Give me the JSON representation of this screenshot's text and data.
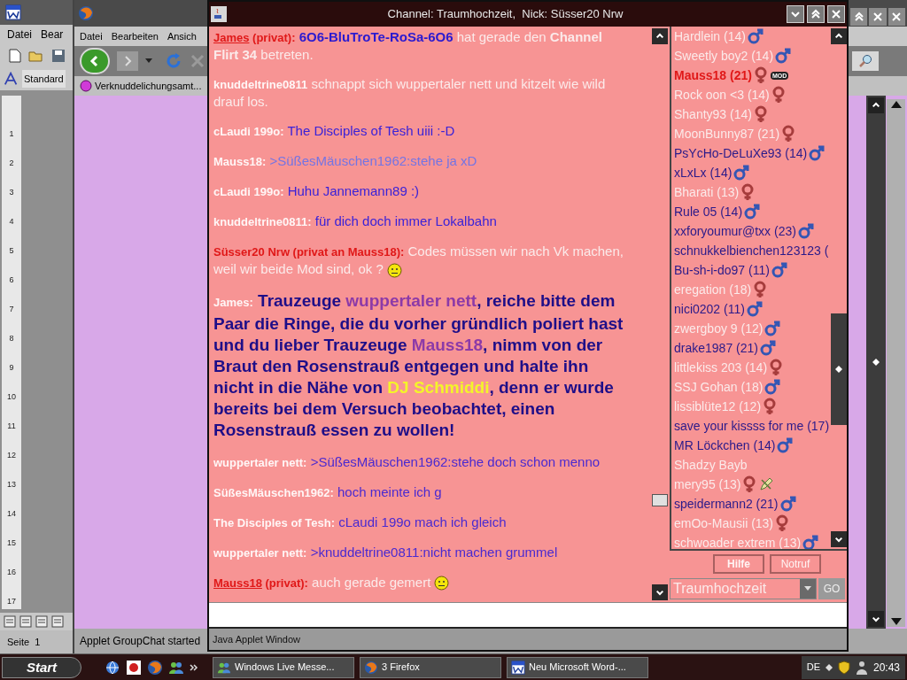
{
  "word": {
    "menu": [
      "Datei",
      "Bear"
    ],
    "style_box": "Standard",
    "ruler_labels": [
      "1",
      "2",
      "3",
      "4",
      "5",
      "6",
      "7",
      "8",
      "9",
      "10",
      "11",
      "12",
      "13",
      "14",
      "15",
      "16",
      "17"
    ],
    "status": "Seite  1"
  },
  "firefox": {
    "menu": [
      "Datei",
      "Bearbeiten",
      "Ansich"
    ],
    "bookmark": "Verknuddelichungsamt...",
    "status": "Applet GroupChat started"
  },
  "chat": {
    "title": "Channel: Traumhochzeit,  Nick: Süsser20 Nrw",
    "messages": [
      {
        "sender": "James",
        "kind": "private",
        "underline": true,
        "tag": "(privat):",
        "parts": [
          {
            "kind": "text",
            "text": "**6O6-BluTroTe-RoSa-6O6**",
            "color": "#2a1ad0"
          },
          {
            "kind": "text",
            "text": " hat gerade den **Channel Flirt 34** betreten.",
            "color": "#fbeaea"
          }
        ]
      },
      {
        "sender": "knuddeltrine0811",
        "kind": "public",
        "underline": false,
        "parts": [
          {
            "kind": "text",
            "text": " schnappt sich wuppertaler nett und kitzelt wie wild drauf los.",
            "color": "#fbeaea"
          }
        ]
      },
      {
        "sender": "cLaudi 199o:",
        "kind": "public",
        "underline": false,
        "parts": [
          {
            "kind": "text",
            "text": "The Disciples of Tesh uiii :-D",
            "color": "#3a22d8"
          }
        ]
      },
      {
        "sender": "Mauss18:",
        "kind": "public",
        "underline": false,
        "parts": [
          {
            "kind": "text",
            "text": ">SüßesMäuschen1962:stehe ja xD",
            "color": "#7474e4"
          }
        ]
      },
      {
        "sender": "cLaudi 199o:",
        "kind": "public",
        "underline": false,
        "parts": [
          {
            "kind": "text",
            "text": "Huhu Jannemann89 :)",
            "color": "#3a22d8"
          }
        ]
      },
      {
        "sender": "knuddeltrine0811:",
        "kind": "public",
        "underline": false,
        "parts": [
          {
            "kind": "text",
            "text": "für dich doch immer Lokalbahn",
            "color": "#3a22d8"
          }
        ]
      },
      {
        "sender": "Süsser20 Nrw (privat an Mauss18):",
        "kind": "private",
        "underline": false,
        "parts": [
          {
            "kind": "text",
            "text": "Codes müssen wir nach Vk machen, weil wir beide Mod sind, ok ?",
            "color": "#fbeaea"
          },
          {
            "kind": "smiley"
          }
        ]
      },
      {
        "sender": "James:",
        "kind": "announcement",
        "underline": false,
        "parts": [
          {
            "kind": "text",
            "text": "Trauzeuge ",
            "color": "#1e0e88"
          },
          {
            "kind": "text",
            "text": "wuppertaler nett",
            "color": "#8c3aa8"
          },
          {
            "kind": "text",
            "text": ", reiche bitte dem Paar die Ringe, die du vorher gründlich poliert hast und du lieber Trauzeuge ",
            "color": "#1e0e88"
          },
          {
            "kind": "text",
            "text": "Mauss18",
            "color": "#8c3aa8"
          },
          {
            "kind": "text",
            "text": ", nimm von der Braut den Rosenstrauß entgegen und halte ihn nicht in die Nähe von ",
            "color": "#1e0e88"
          },
          {
            "kind": "text",
            "text": "DJ Schmiddi",
            "color": "#f4f42a"
          },
          {
            "kind": "text",
            "text": ", denn er wurde bereits bei dem Versuch beobachtet, einen Rosenstrauß essen zu wollen!",
            "color": "#1e0e88"
          }
        ]
      },
      {
        "sender": "wuppertaler nett:",
        "kind": "public",
        "underline": false,
        "parts": [
          {
            "kind": "text",
            "text": ">SüßesMäuschen1962:stehe doch schon menno",
            "color": "#4a2ad0"
          }
        ]
      },
      {
        "sender": "SüßesMäuschen1962:",
        "kind": "public",
        "underline": false,
        "parts": [
          {
            "kind": "text",
            "text": "hoch meinte ich g",
            "color": "#4a2ad0"
          }
        ]
      },
      {
        "sender": "The Disciples of Tesh:",
        "kind": "public",
        "underline": false,
        "parts": [
          {
            "kind": "text",
            "text": "cLaudi  199o  mach ich gleich",
            "color": "#4a2ad0"
          }
        ]
      },
      {
        "sender": "wuppertaler nett:",
        "kind": "public",
        "underline": false,
        "parts": [
          {
            "kind": "text",
            "text": ">knuddeltrine0811:nicht machen grummel",
            "color": "#4a2ad0"
          }
        ]
      },
      {
        "sender": "Mauss18",
        "kind": "private",
        "underline": true,
        "tag": "(privat):",
        "parts": [
          {
            "kind": "text",
            "text": "auch gerade gemert",
            "color": "#fbeaea"
          },
          {
            "kind": "smiley"
          }
        ]
      }
    ],
    "users": [
      {
        "name": "Hardlein (14)",
        "color": "#fbeaea",
        "bold": false,
        "kind": "male",
        "pencil": false
      },
      {
        "name": "Sweetly boy2 (14)",
        "color": "#fbeaea",
        "bold": false,
        "kind": "male",
        "pencil": false
      },
      {
        "name": "Mauss18 (21)",
        "color": "#e01818",
        "bold": true,
        "kind": "female",
        "badge": "MOD",
        "pencil": false
      },
      {
        "name": "Rock oon <3 (14)",
        "color": "#fbeaea",
        "bold": false,
        "kind": "female",
        "pencil": false
      },
      {
        "name": "Shanty93 (14)",
        "color": "#fbeaea",
        "bold": false,
        "kind": "female",
        "pencil": false
      },
      {
        "name": "MoonBunny87 (21)",
        "color": "#fbeaea",
        "bold": false,
        "kind": "female",
        "pencil": false
      },
      {
        "name": "PsYcHo-DeLuXe93 (14)",
        "color": "#2a1a8a",
        "bold": false,
        "kind": "male",
        "pencil": false
      },
      {
        "name": "xLxLx (14)",
        "color": "#2a1a8a",
        "bold": false,
        "kind": "male",
        "pencil": false
      },
      {
        "name": "Bharati (13)",
        "color": "#fbeaea",
        "bold": false,
        "kind": "female",
        "pencil": false
      },
      {
        "name": "Rule 05 (14)",
        "color": "#2a1a8a",
        "bold": false,
        "kind": "male",
        "pencil": false
      },
      {
        "name": "xxforyoumur@txx (23)",
        "color": "#2a1a8a",
        "bold": false,
        "kind": "male",
        "pencil": false
      },
      {
        "name": "schnukkelbienchen123123 (",
        "color": "#2a1a8a",
        "bold": false,
        "kind": "plain",
        "pencil": false
      },
      {
        "name": "Bu-sh-i-do97 (11)",
        "color": "#2a1a8a",
        "bold": false,
        "kind": "male",
        "pencil": false
      },
      {
        "name": "eregation (18)",
        "color": "#fbeaea",
        "bold": false,
        "kind": "female",
        "pencil": false
      },
      {
        "name": "nici0202 (11)",
        "color": "#2a1a8a",
        "bold": false,
        "kind": "male",
        "pencil": false
      },
      {
        "name": "zwergboy 9 (12)",
        "color": "#fbeaea",
        "bold": false,
        "kind": "male",
        "pencil": false
      },
      {
        "name": "drake1987 (21)",
        "color": "#2a1a8a",
        "bold": false,
        "kind": "male",
        "pencil": false
      },
      {
        "name": "littlekiss 203 (14)",
        "color": "#fbeaea",
        "bold": false,
        "kind": "female",
        "pencil": false
      },
      {
        "name": "SSJ Gohan (18)",
        "color": "#fbeaea",
        "bold": false,
        "kind": "male",
        "pencil": false
      },
      {
        "name": "lissiblüte12 (12)",
        "color": "#fbeaea",
        "bold": false,
        "kind": "female",
        "pencil": false
      },
      {
        "name": "save your kissss for me (17)",
        "color": "#2a1a8a",
        "bold": false,
        "kind": "plain",
        "pencil": false
      },
      {
        "name": "MR Löckchen (14)",
        "color": "#2a1a8a",
        "bold": false,
        "kind": "male",
        "pencil": false
      },
      {
        "name": "Shadzy Bayb",
        "color": "#fbeaea",
        "bold": false,
        "kind": "plain",
        "pencil": false
      },
      {
        "name": "mery95 (13)",
        "color": "#fbeaea",
        "bold": false,
        "kind": "female",
        "pencil": true
      },
      {
        "name": "speidermann2 (21)",
        "color": "#2a1a8a",
        "bold": false,
        "kind": "male",
        "pencil": false
      },
      {
        "name": "emOo-Mausii (13)",
        "color": "#fbeaea",
        "bold": false,
        "kind": "female",
        "pencil": false
      },
      {
        "name": "schwoader extrem (13)",
        "color": "#fbeaea",
        "bold": false,
        "kind": "male",
        "pencil": false
      }
    ],
    "buttons": [
      {
        "label": "Hilfe",
        "bold": true
      },
      {
        "label": "Notruf",
        "bold": false
      }
    ],
    "channel_select": "Traumhochzeit",
    "go_button": "GO",
    "status": "Java Applet Window"
  },
  "taskbar": {
    "start": "Start",
    "tasks": [
      "Windows Live Messe...",
      "3 Firefox",
      "Neu Microsoft Word-..."
    ],
    "language": "DE",
    "clock": "20:43"
  }
}
